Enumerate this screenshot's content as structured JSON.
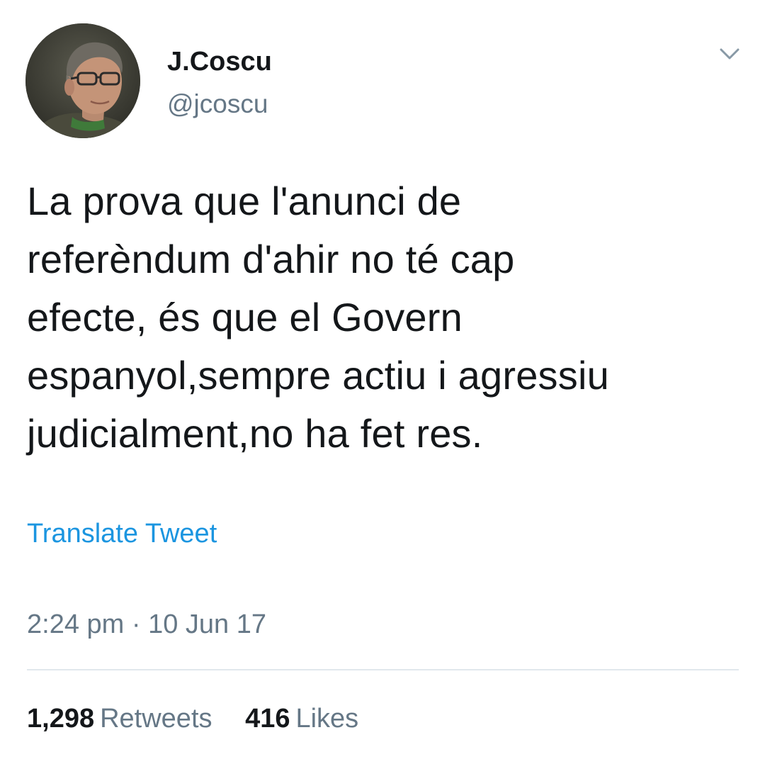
{
  "author": {
    "display_name": "J.Coscu",
    "handle": "@jcoscu"
  },
  "tweet": {
    "text_lines": [
      "La prova que l'anunci de",
      "referèndum d'ahir no té cap",
      "efecte, és que el Govern",
      "espanyol,sempre actiu i agressiu",
      "judicialment,no ha fet res."
    ],
    "translate_label": "Translate Tweet",
    "time": "2:24 pm",
    "separator": "·",
    "date": "10 Jun 17"
  },
  "stats": {
    "retweets_count": "1,298",
    "retweets_label": "Retweets",
    "likes_count": "416",
    "likes_label": "Likes"
  },
  "icons": {
    "menu": "chevron-down-icon",
    "avatar": "profile-photo"
  },
  "colors": {
    "link": "#1b95e0",
    "secondary_text": "#657786",
    "primary_text": "#14171a",
    "divider": "#e1e8ed"
  }
}
